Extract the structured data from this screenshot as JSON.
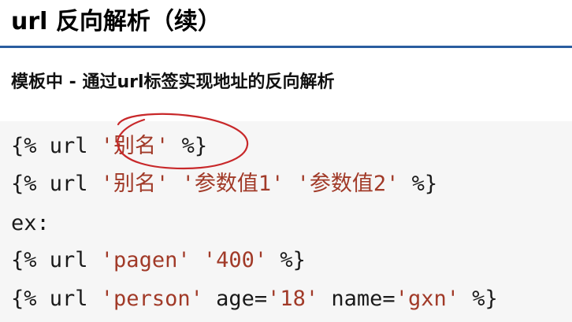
{
  "slide": {
    "title": "url 反向解析（续）",
    "subtitle": "模板中 - 通过url标签实现地址的反向解析"
  },
  "code": {
    "line1": {
      "open": "{% url ",
      "alias": "'别名'",
      "close": " %}"
    },
    "line2": {
      "open": "{% url ",
      "alias": "'别名'",
      "sep1": " ",
      "arg1": "'参数值1'",
      "sep2": " ",
      "arg2": "'参数值2'",
      "close": " %}"
    },
    "line3": {
      "text": "ex:"
    },
    "line4": {
      "open": "{% url ",
      "name": "'pagen'",
      "sep": " ",
      "arg": "'400'",
      "close": " %}"
    },
    "line5": {
      "open": "{% url ",
      "name": "'person'",
      "kw1": " age=",
      "val1": "'18'",
      "kw2": " name=",
      "val2": "'gxn'",
      "close": " %}"
    }
  },
  "annotation": {
    "color": "#c8282a"
  },
  "colors": {
    "title_rule": "#2a5d9f",
    "string": "#a13a28",
    "code_background": "#f6f6f6"
  }
}
